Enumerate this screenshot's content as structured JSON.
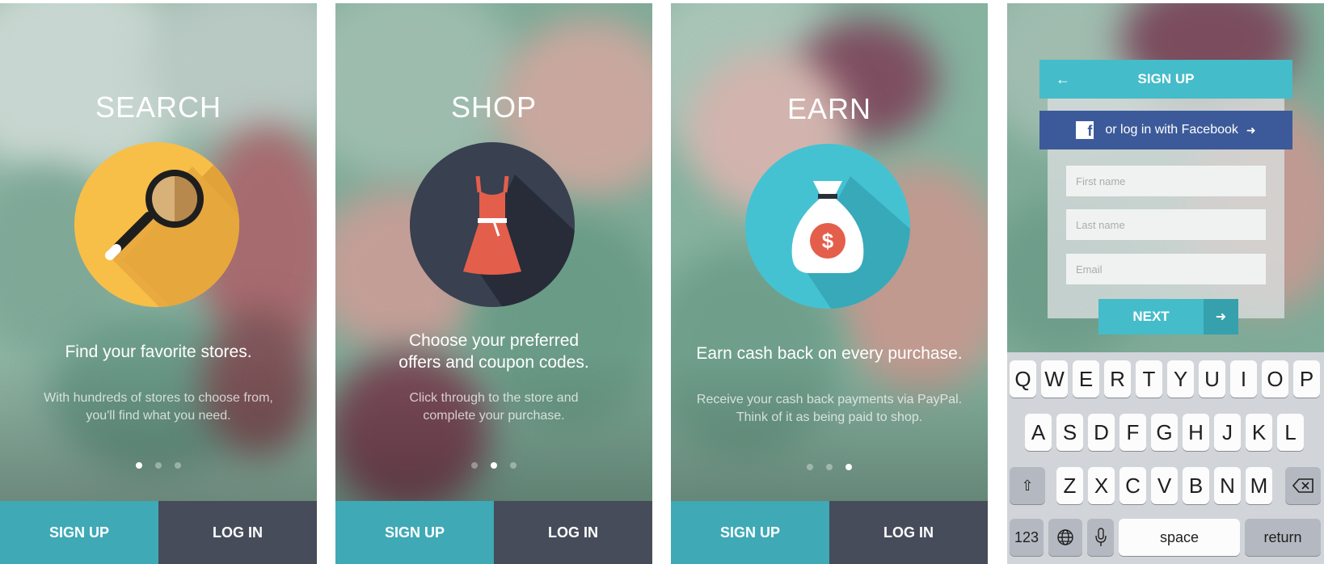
{
  "screens": [
    {
      "title": "SEARCH",
      "headline": "Find your favorite stores.",
      "subtext_line1": "With hundreds of stores to choose from,",
      "subtext_line2": "you'll find what you need.",
      "icon": "magnifier-icon",
      "circle_color": "#f7bf48",
      "active_page": 1
    },
    {
      "title": "SHOP",
      "headline_line1": "Choose your preferred",
      "headline_line2": "offers and coupon codes.",
      "subtext_line1": "Click through to the store and",
      "subtext_line2": "complete your purchase.",
      "icon": "dress-icon",
      "circle_color": "#394050",
      "active_page": 2
    },
    {
      "title": "EARN",
      "headline": "Earn cash back on every purchase.",
      "subtext_line1": "Receive your cash back payments via PayPal.",
      "subtext_line2": "Think of it as being paid to shop.",
      "icon": "money-bag-icon",
      "circle_color": "#45c2d2",
      "active_page": 3
    }
  ],
  "pagination": {
    "total_pages": 3
  },
  "buttons": {
    "signup_label": "SIGN UP",
    "login_label": "LOG IN"
  },
  "signup": {
    "header_title": "SIGN UP",
    "back_icon": "arrow-left-icon",
    "facebook_label": "or log in with Facebook",
    "first_name_placeholder": "First name",
    "last_name_placeholder": "Last name",
    "email_placeholder": "Email",
    "next_label": "NEXT"
  },
  "keyboard": {
    "row1": [
      "Q",
      "W",
      "E",
      "R",
      "T",
      "Y",
      "U",
      "I",
      "O",
      "P"
    ],
    "row2": [
      "A",
      "S",
      "D",
      "F",
      "G",
      "H",
      "J",
      "K",
      "L"
    ],
    "row3": [
      "Z",
      "X",
      "C",
      "V",
      "B",
      "N",
      "M"
    ],
    "numbers_label": "123",
    "space_label": "space",
    "return_label": "return"
  },
  "colors": {
    "teal": "#3fa9b6",
    "slate": "#464c5a",
    "facebook_blue": "#3c5a9a",
    "signup_header": "#45bcc9",
    "yellow": "#f7bf48",
    "coral": "#e45e4c"
  }
}
